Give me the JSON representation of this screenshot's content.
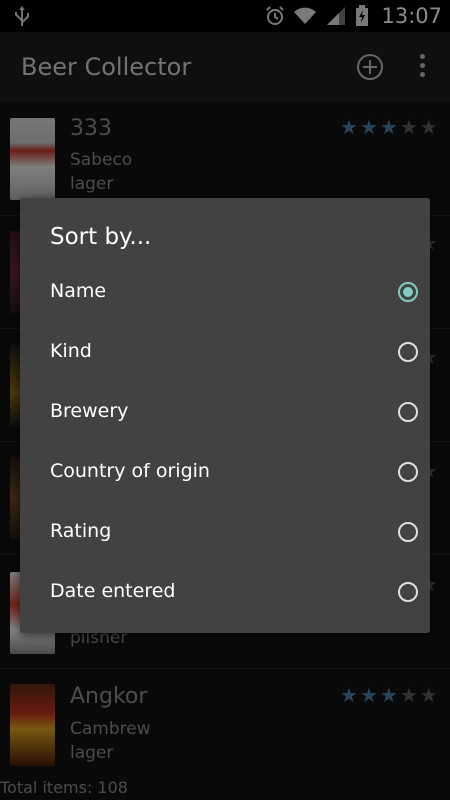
{
  "status_bar": {
    "time": "13:07",
    "icons": [
      "usb-icon",
      "alarm-icon",
      "wifi-icon",
      "signal-icon",
      "battery-charging-icon"
    ]
  },
  "app": {
    "title": "Beer Collector",
    "actions": [
      "add-icon",
      "overflow-menu-icon"
    ]
  },
  "beers": [
    {
      "name": "333",
      "brewery": "Sabeco",
      "kind": "lager",
      "rating": 3,
      "max_rating": 5
    },
    {
      "name": "",
      "brewery": "",
      "kind": "",
      "rating": 0,
      "max_rating": 5
    },
    {
      "name": "",
      "brewery": "",
      "kind": "",
      "rating": 0,
      "max_rating": 5
    },
    {
      "name": "",
      "brewery": "",
      "kind": "",
      "rating": 0,
      "max_rating": 5
    },
    {
      "name": "",
      "brewery": "",
      "kind": "pilsner",
      "rating": 0,
      "max_rating": 5
    },
    {
      "name": "Angkor",
      "brewery": "Cambrew",
      "kind": "lager",
      "rating": 3,
      "max_rating": 5
    }
  ],
  "footer": {
    "total": "Total items: 108"
  },
  "sort_dialog": {
    "title": "Sort by...",
    "options": [
      {
        "label": "Name",
        "selected": true
      },
      {
        "label": "Kind",
        "selected": false
      },
      {
        "label": "Brewery",
        "selected": false
      },
      {
        "label": "Country of origin",
        "selected": false
      },
      {
        "label": "Rating",
        "selected": false
      },
      {
        "label": "Date entered",
        "selected": false
      }
    ]
  },
  "colors": {
    "star_on": "#4a7fa6",
    "star_off": "#5a5a5a",
    "radio_selected": "#80cbc4",
    "dialog_bg": "#424242"
  }
}
